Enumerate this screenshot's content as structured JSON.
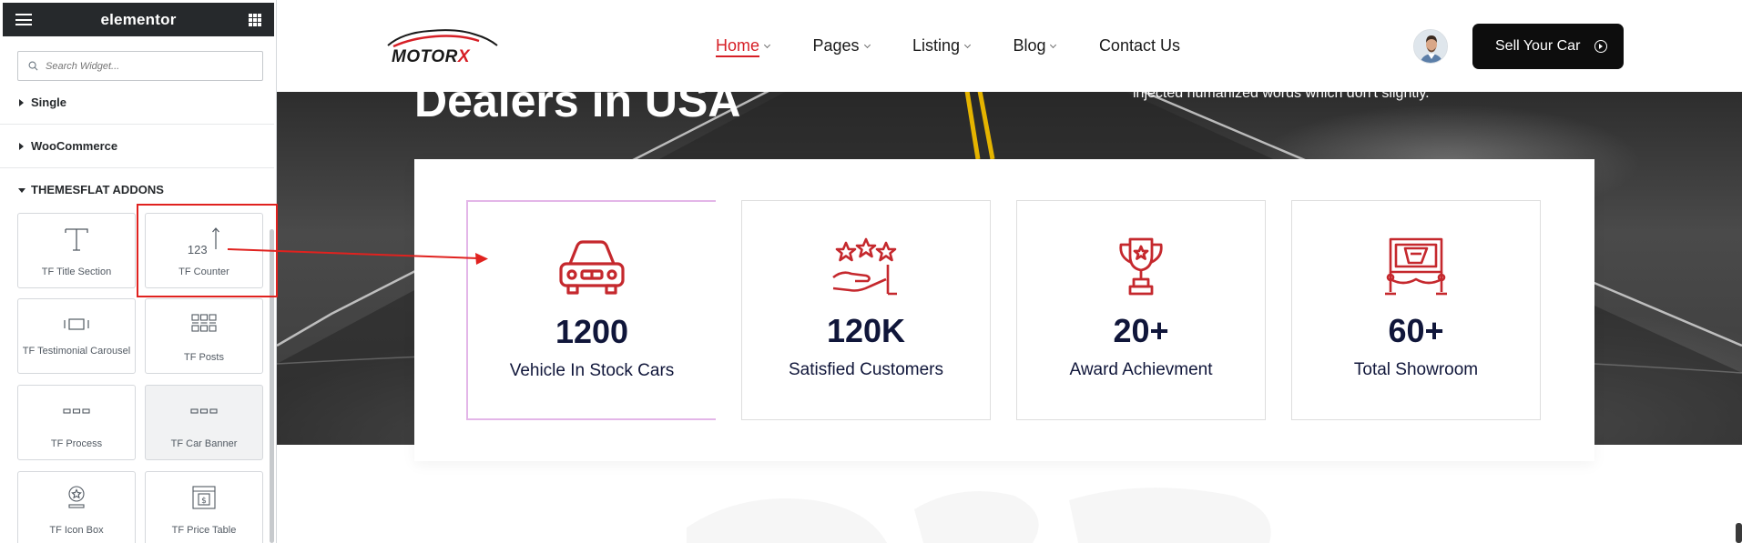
{
  "panel": {
    "brand": "elementor",
    "search_placeholder": "Search Widget...",
    "categories": [
      {
        "label": "Single"
      },
      {
        "label": "WooCommerce"
      },
      {
        "label": "THEMESFLAT ADDONS"
      }
    ],
    "widgets": [
      {
        "label": "TF Title Section",
        "icon": "title-section-icon"
      },
      {
        "label": "TF Counter",
        "icon": "counter-icon"
      },
      {
        "label": "TF Testimonial Carousel",
        "icon": "testimonial-carousel-icon"
      },
      {
        "label": "TF Posts",
        "icon": "posts-grid-icon"
      },
      {
        "label": "TF Process",
        "icon": "process-icon"
      },
      {
        "label": "TF Car Banner",
        "icon": "car-banner-icon"
      },
      {
        "label": "TF Icon Box",
        "icon": "icon-box-icon"
      },
      {
        "label": "TF Price Table",
        "icon": "price-table-icon"
      }
    ],
    "counter_glyph": "123"
  },
  "site": {
    "logo_text": "MOTOR",
    "logo_x": "X",
    "nav": [
      {
        "label": "Home",
        "active": true,
        "has_dropdown": true
      },
      {
        "label": "Pages",
        "has_dropdown": true
      },
      {
        "label": "Listing",
        "has_dropdown": true
      },
      {
        "label": "Blog",
        "has_dropdown": true
      },
      {
        "label": "Contact Us",
        "has_dropdown": false
      }
    ],
    "sell_button": "Sell Your Car",
    "hero_title": "Dealers in USA",
    "hero_subtitle": "injected humanized words which don't slightly.",
    "stats": [
      {
        "value": "1200",
        "label": "Vehicle In Stock Cars",
        "icon": "car-icon"
      },
      {
        "value": "120K",
        "label": "Satisfied Customers",
        "icon": "stars-hand-icon"
      },
      {
        "value": "20+",
        "label": "Award Achievment",
        "icon": "trophy-icon"
      },
      {
        "value": "60+",
        "label": "Total Showroom",
        "icon": "showroom-icon"
      }
    ]
  },
  "colors": {
    "accent": "#d61f26",
    "annotation": "#e0221f",
    "panel_header": "#26292c",
    "stat_text": "#10163a"
  }
}
